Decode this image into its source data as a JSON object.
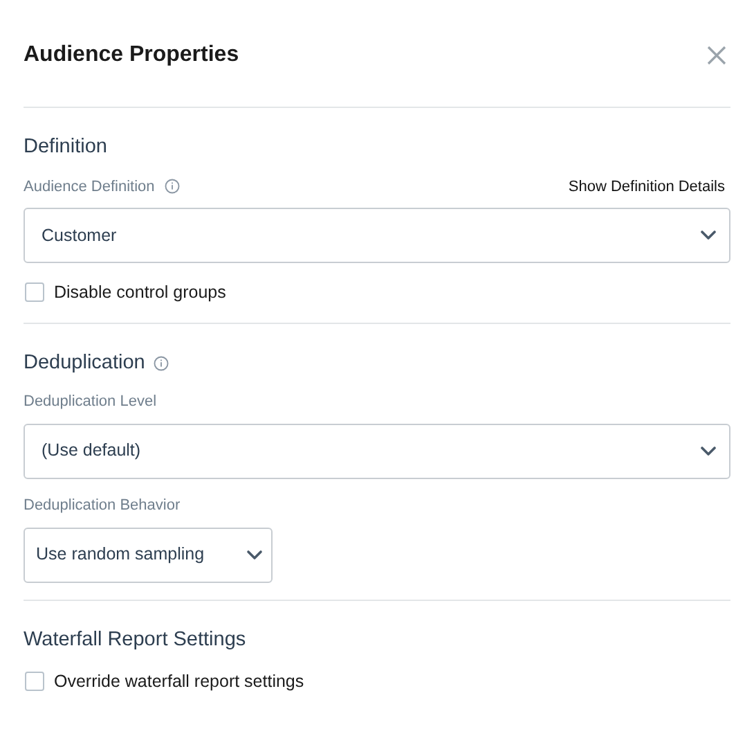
{
  "dialog": {
    "title": "Audience Properties"
  },
  "sections": [
    {
      "heading": "Definition",
      "info": false,
      "items": [
        {
          "kind": "select",
          "label": "Audience Definition",
          "info": true,
          "link": "Show Definition Details",
          "value": "Customer",
          "wide": true
        },
        {
          "kind": "checkbox",
          "label": "Disable control groups",
          "checked": false
        }
      ]
    },
    {
      "heading": "Deduplication",
      "info": true,
      "items": [
        {
          "kind": "select",
          "label": "Deduplication Level",
          "info": false,
          "value": "(Use default)",
          "wide": true
        },
        {
          "kind": "select",
          "label": "Deduplication Behavior",
          "info": false,
          "value": "Use random sampling",
          "wide": false
        }
      ]
    },
    {
      "heading": "Waterfall Report Settings",
      "info": false,
      "items": [
        {
          "kind": "checkbox",
          "label": "Override waterfall report settings",
          "checked": false
        }
      ]
    }
  ]
}
